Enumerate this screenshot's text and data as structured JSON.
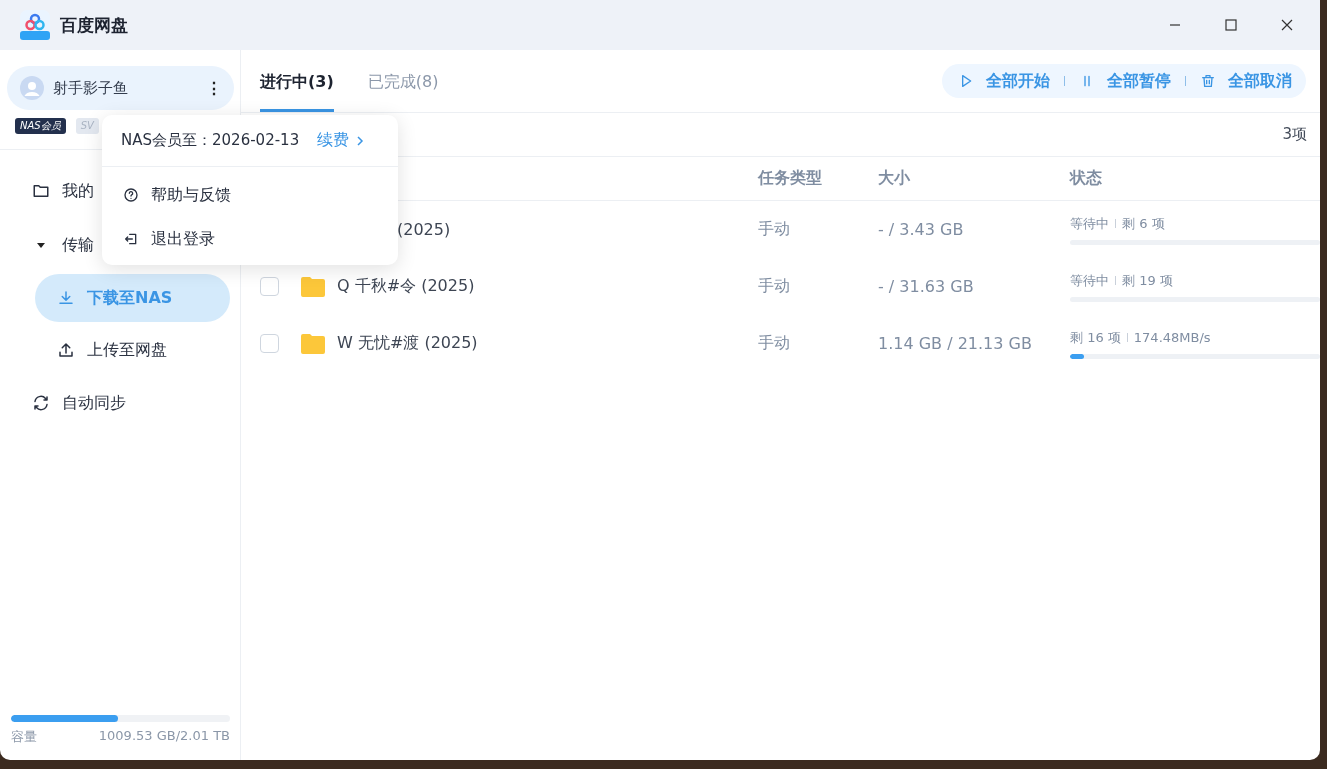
{
  "window": {
    "title": "百度网盘"
  },
  "sidebar": {
    "user": {
      "name": "射手影子鱼",
      "more": "⋮"
    },
    "badges": [
      {
        "kind": "dark",
        "label": "NAS会员"
      },
      {
        "kind": "light",
        "label": "SV"
      }
    ],
    "items": [
      {
        "kind": "folder",
        "label": "我的",
        "selected": false
      },
      {
        "kind": "group",
        "label": "传输",
        "expanded": true,
        "children": [
          {
            "kind": "download",
            "label": "下载至NAS",
            "selected": true
          },
          {
            "kind": "upload",
            "label": "上传至网盘",
            "selected": false
          }
        ]
      },
      {
        "kind": "sync",
        "label": "自动同步",
        "selected": false
      }
    ],
    "storage": {
      "label": "容量",
      "value": "1009.53 GB/2.01 TB",
      "level": 0.49
    }
  },
  "tabs": [
    {
      "label": "进行中(3)",
      "selected": true
    },
    {
      "label": "已完成(8)",
      "selected": false
    }
  ],
  "actions": [
    {
      "kind": "play",
      "label": "全部开始"
    },
    {
      "kind": "pause",
      "label": "全部暂停"
    },
    {
      "kind": "trash",
      "label": "全部取消"
    }
  ],
  "count": "3项",
  "table": {
    "columns": [
      "任务类型",
      "大小",
      "状态"
    ],
    "rows": [
      {
        "kind": "covered",
        "name": "(2025)",
        "type": "手动",
        "size": "- / 3.43 GB",
        "status": [
          "等待中",
          "剩 6 项"
        ]
      },
      {
        "kind": "task",
        "checked": false,
        "name": "Q 千秋#令 (2025)",
        "type": "手动",
        "size": "- / 31.63 GB",
        "status": [
          "等待中",
          "剩 19 项"
        ]
      },
      {
        "kind": "task",
        "checked": false,
        "name": "W 无忧#渡 (2025)",
        "type": "手动",
        "size": "1.14 GB / 21.13 GB",
        "status": [
          "剩 16 项",
          "174.48MB/s"
        ],
        "level": 0.056
      }
    ]
  },
  "menu": {
    "membership": "NAS会员至：2026-02-13",
    "renew": "续费",
    "items": [
      {
        "kind": "help",
        "label": "帮助与反馈"
      },
      {
        "kind": "logout",
        "label": "退出登录"
      }
    ]
  }
}
